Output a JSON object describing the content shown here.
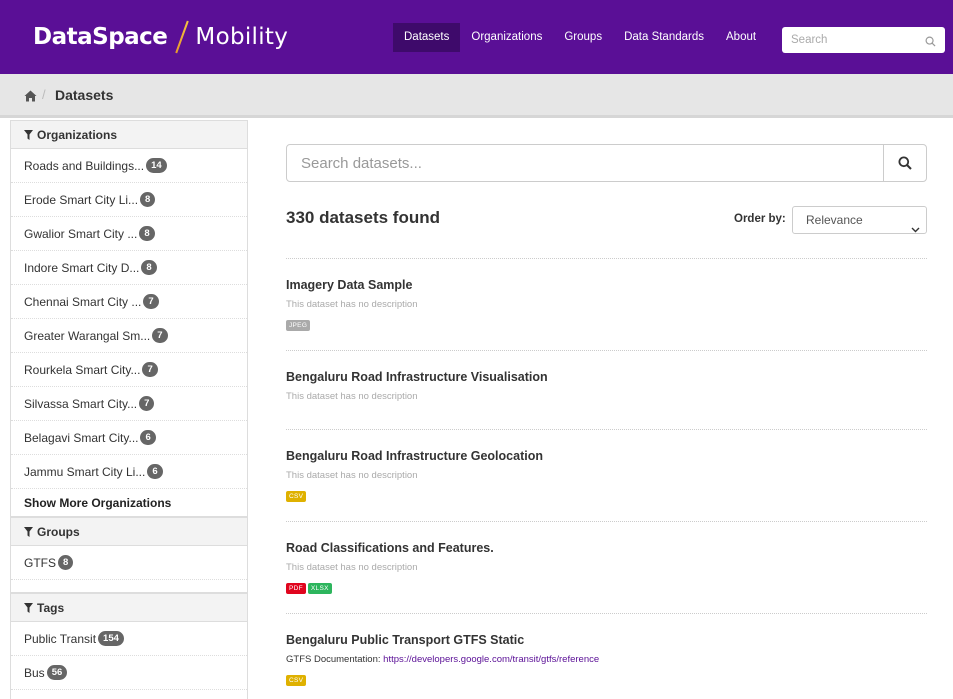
{
  "header": {
    "logo_main": "DataSpace",
    "logo_sub": "Mobility",
    "nav": [
      "Datasets",
      "Organizations",
      "Groups",
      "Data Standards",
      "About"
    ],
    "search_placeholder": "Search"
  },
  "breadcrumb": {
    "current": "Datasets"
  },
  "sidebar": {
    "organizations_heading": "Organizations",
    "organizations": [
      {
        "label": "Roads and Buildings...",
        "count": "14"
      },
      {
        "label": "Erode Smart City Li...",
        "count": "8"
      },
      {
        "label": "Gwalior Smart City ...",
        "count": "8"
      },
      {
        "label": "Indore Smart City D...",
        "count": "8"
      },
      {
        "label": "Chennai Smart City ...",
        "count": "7"
      },
      {
        "label": "Greater Warangal Sm...",
        "count": "7"
      },
      {
        "label": "Rourkela Smart City...",
        "count": "7"
      },
      {
        "label": "Silvassa Smart City...",
        "count": "7"
      },
      {
        "label": "Belagavi Smart City...",
        "count": "6"
      },
      {
        "label": "Jammu Smart City Li...",
        "count": "6"
      }
    ],
    "show_more": "Show More Organizations",
    "groups_heading": "Groups",
    "groups": [
      {
        "label": "GTFS",
        "count": "8"
      }
    ],
    "tags_heading": "Tags",
    "tags": [
      {
        "label": "Public Transit",
        "count": "154"
      },
      {
        "label": "Bus",
        "count": "56"
      }
    ]
  },
  "main": {
    "search_placeholder": "Search datasets...",
    "found": "330 datasets found",
    "order_label": "Order by:",
    "order_value": "Relevance",
    "datasets": [
      {
        "title": "Imagery Data Sample",
        "desc": "This dataset has no description",
        "formats": [
          {
            "label": "JPEG",
            "color": "#aaaaaa"
          }
        ]
      },
      {
        "title": "Bengaluru Road Infrastructure Visualisation",
        "desc": "This dataset has no description",
        "formats": []
      },
      {
        "title": "Bengaluru Road Infrastructure Geolocation",
        "desc": "This dataset has no description",
        "formats": [
          {
            "label": "CSV",
            "color": "#dfb100"
          }
        ]
      },
      {
        "title": "Road Classifications and Features.",
        "desc": "This dataset has no description",
        "formats": [
          {
            "label": "PDF",
            "color": "#e0051e"
          },
          {
            "label": "XLSX",
            "color": "#2db55d"
          }
        ]
      },
      {
        "title": "Bengaluru Public Transport GTFS Static",
        "desc_prefix": "GTFS Documentation: ",
        "desc_link": "https://developers.google.com/transit/gtfs/reference",
        "formats": [
          {
            "label": "CSV",
            "color": "#dfb100"
          }
        ]
      }
    ]
  }
}
